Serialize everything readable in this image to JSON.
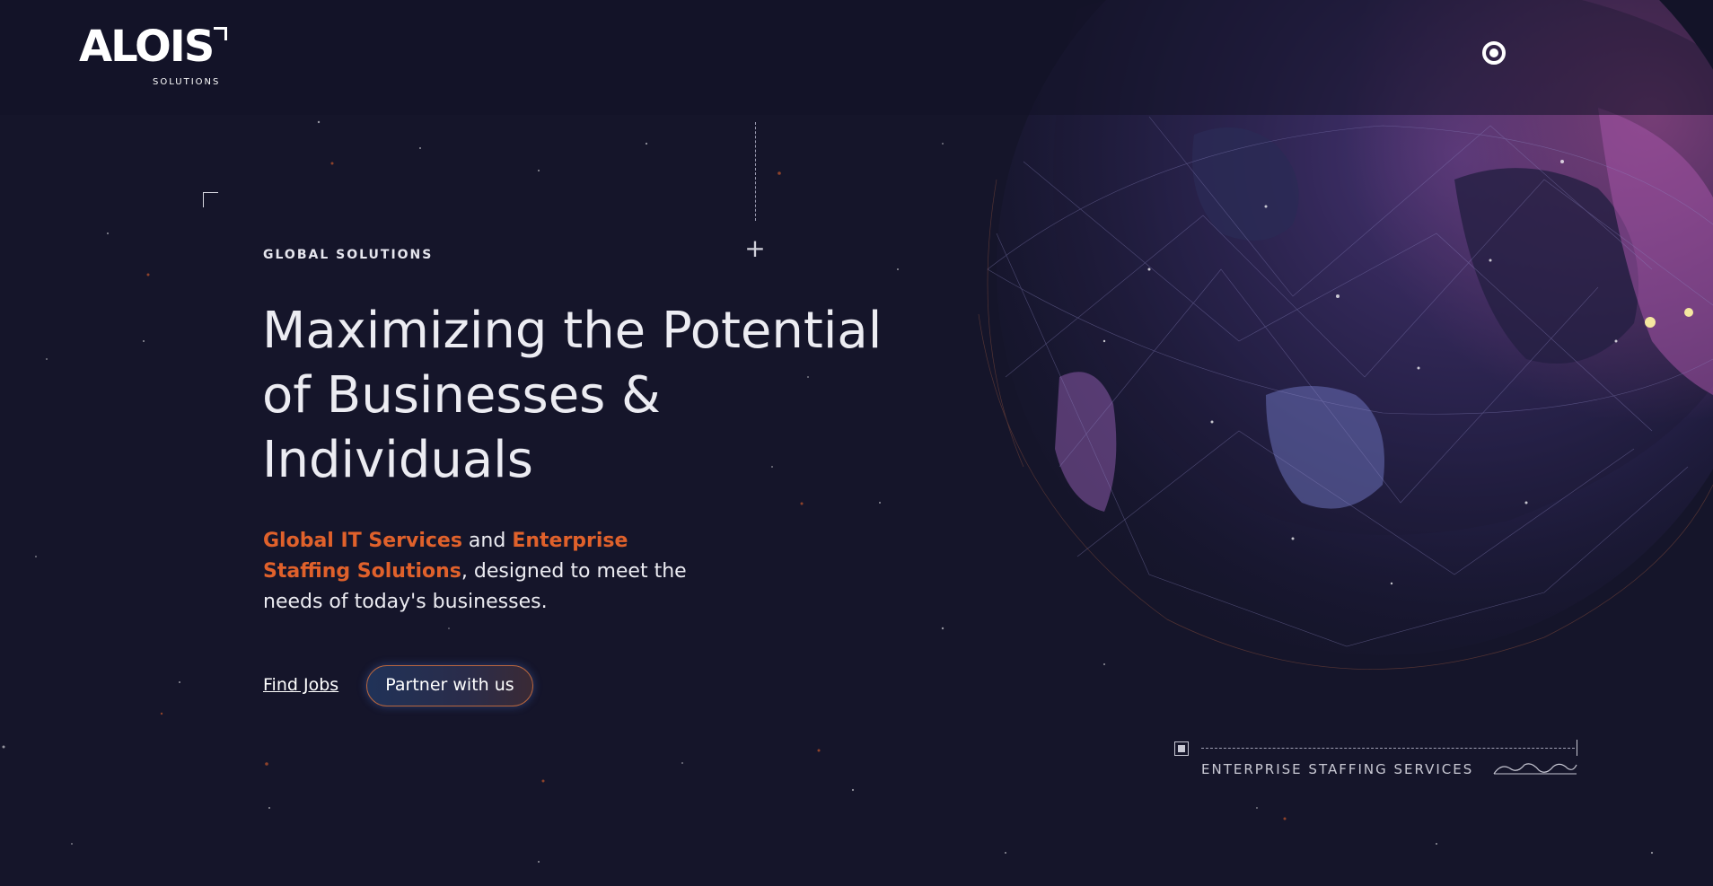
{
  "header": {
    "logo_text": "ALOIS",
    "logo_subtext": "SOLUTIONS",
    "record_icon": "record-circle-icon"
  },
  "hero": {
    "eyebrow": "GLOBAL SOLUTIONS",
    "headline_line1": "Maximizing the Potential",
    "headline_line2": "of Businesses &",
    "headline_line3": "Individuals",
    "subtext_accent1": "Global IT Services",
    "subtext_and": " and ",
    "subtext_accent2": "Enterprise Staffing Solutions",
    "subtext_rest": ", designed to meet the needs of today's businesses.",
    "find_jobs_label": "Find Jobs",
    "partner_label": "Partner with us"
  },
  "badge": {
    "label": "ENTERPRISE STAFFING SERVICES",
    "wave_icon": "wave-pattern-icon"
  },
  "colors": {
    "background": "#15152a",
    "accent": "#e0612b",
    "button_border": "#b8663e"
  }
}
